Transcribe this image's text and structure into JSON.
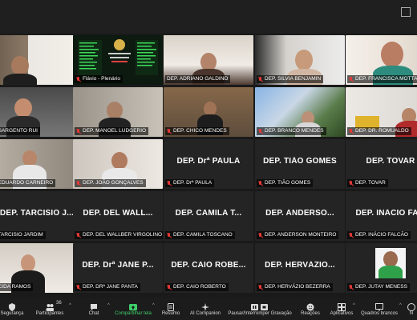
{
  "tiles": [
    {
      "caption": "",
      "big": ""
    },
    {
      "caption": "Flávio - Plenário",
      "big": ""
    },
    {
      "caption": "DEP. ADRIANO GALDINO",
      "big": ""
    },
    {
      "caption": "DEP. SILVIA BENJAMIN",
      "big": ""
    },
    {
      "caption": "DEP. FRANCISCA MOTTA",
      "big": ""
    },
    {
      "caption": ". SARGENTO RUI",
      "big": ""
    },
    {
      "caption": "DEP. MANOEL LUDGERIO",
      "big": ""
    },
    {
      "caption": "DEP. CHICO MENDES",
      "big": ""
    },
    {
      "caption": "DEP. BRANCO MENDES",
      "big": ""
    },
    {
      "caption": "DEP. DR. ROMUALDO",
      "big": ""
    },
    {
      "caption": ". EDUARDO CARNEIRO",
      "big": ""
    },
    {
      "caption": "DEP. JOÃO GONÇALVES",
      "big": ""
    },
    {
      "caption": "DEP. Drª PAULA",
      "big": "DEP. Drª PAULA"
    },
    {
      "caption": "DEP. TIÃO GOMES",
      "big": "DEP. TIÃO GOMES"
    },
    {
      "caption": "DEP. TOVAR",
      "big": "DEP. TOVAR"
    },
    {
      "caption": ". TARCISIO JARDIM",
      "big": "DEP. TARCISIO J..."
    },
    {
      "caption": "DEP. DEL WALLBER VIRGOLINO",
      "big": "DEP. DEL WALL..."
    },
    {
      "caption": "DEP. CAMILA TOSCANO",
      "big": "DEP. CAMILA T..."
    },
    {
      "caption": "DEP. ANDERSON MONTEIRO",
      "big": "DEP. ANDERSO..."
    },
    {
      "caption": "DEP. INÁCIO FALCÃO",
      "big": "DEP. INÁCIO FA..."
    },
    {
      "caption": ". CIDA RAMOS",
      "big": ""
    },
    {
      "caption": "DEP. DRª JANE PANTA",
      "big": "DEP. Drª JANE P..."
    },
    {
      "caption": "DEP. CAIO ROBERTO",
      "big": "DEP. CAIO ROBE..."
    },
    {
      "caption": "DEP. HERVÁZIO BEZERRA",
      "big": "DEP. HERVÁZIO..."
    },
    {
      "caption": "DEP. JUTAY MENESS",
      "big": ""
    }
  ],
  "toolbar": {
    "security": "Segurança",
    "participants": "Participantes",
    "participants_count": "36",
    "chat": "Chat",
    "share": "Compartilhar tela",
    "summary": "Resumo",
    "companion": "AI Companion",
    "pause": "Pausar/Interromper Gravação",
    "reactions": "Reações",
    "apps": "Aplicativos",
    "whiteboards": "Quadros brancos",
    "more": "N"
  }
}
